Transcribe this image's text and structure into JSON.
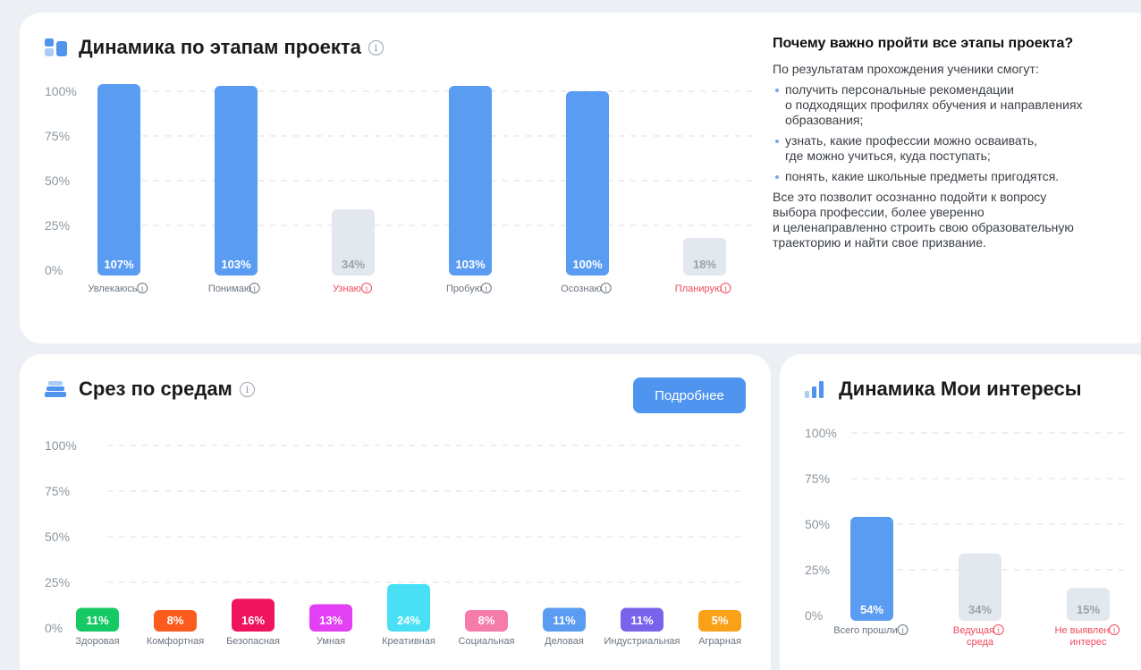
{
  "stages": {
    "title": "Динамика по этапам проекта",
    "chart_data": {
      "type": "bar",
      "title": "Динамика по этапам проекта",
      "y_ticks": [
        "100%",
        "75%",
        "50%",
        "25%",
        "0%"
      ],
      "ylim": [
        0,
        100
      ],
      "grid": true,
      "categories": [
        "Увлекаюсь",
        "Понимаю",
        "Узнаю",
        "Пробую",
        "Осознаю",
        "Планирую"
      ],
      "values": [
        107,
        103,
        34,
        103,
        100,
        18
      ],
      "value_labels": [
        "107%",
        "103%",
        "34%",
        "103%",
        "100%",
        "18%"
      ],
      "status": [
        "ok",
        "ok",
        "low",
        "ok",
        "ok",
        "low"
      ]
    }
  },
  "info": {
    "heading": "Почему важно пройти все этапы проекта?",
    "intro": "По результатам прохождения ученики смогут:",
    "bullets": [
      "получить персональные рекомендации\nо подходящих профилях обучения и направлениях\nобразования;",
      "узнать, какие профессии можно осваивать,\nгде можно учиться, куда поступать;",
      "понять, какие школьные предметы пригодятся."
    ],
    "outro": "Все это позволит осознанно подойти к вопросу\nвыбора профессии, более уверенно\nи целенаправленно строить свою образовательную\nтраекторию и найти свое призвание."
  },
  "environments": {
    "title": "Срез по средам",
    "button_label": "Подробнее",
    "chart_data": {
      "type": "bar",
      "title": "Срез по средам",
      "y_ticks": [
        "100%",
        "75%",
        "50%",
        "25%",
        "0%"
      ],
      "ylim": [
        0,
        100
      ],
      "grid": true,
      "categories": [
        "Здоровая",
        "Комфортная",
        "Безопасная",
        "Умная",
        "Креативная",
        "Социальная",
        "Деловая",
        "Индустриальная",
        "Аграрная"
      ],
      "values": [
        11,
        8,
        16,
        13,
        24,
        8,
        11,
        11,
        5
      ],
      "value_labels": [
        "11%",
        "8%",
        "16%",
        "13%",
        "24%",
        "8%",
        "11%",
        "11%",
        "5%"
      ],
      "colors": [
        "#17c964",
        "#fb5c1e",
        "#f0135e",
        "#e33ff4",
        "#49e0f6",
        "#f57ba9",
        "#5a9cf2",
        "#7a63ea",
        "#fba117"
      ]
    }
  },
  "interests": {
    "title": "Динамика Мои интересы",
    "chart_data": {
      "type": "bar",
      "title": "Динамика Мои интересы",
      "y_ticks": [
        "100%",
        "75%",
        "50%",
        "25%",
        "0%"
      ],
      "ylim": [
        0,
        100
      ],
      "grid": true,
      "categories": [
        [
          "Всего прошли"
        ],
        [
          "Ведущая",
          "среда"
        ],
        [
          "Не выявлен",
          "интерес"
        ]
      ],
      "values": [
        54,
        34,
        15
      ],
      "value_labels": [
        "54%",
        "34%",
        "15%"
      ],
      "status": [
        "ok",
        "low",
        "low"
      ]
    }
  },
  "colors": {
    "primary": "#5a9cf2",
    "muted_bar": "#e3e7ee",
    "muted_text": "#9aa3ad",
    "warning_text": "#ef4a5c",
    "grid": "#d9dde3"
  }
}
